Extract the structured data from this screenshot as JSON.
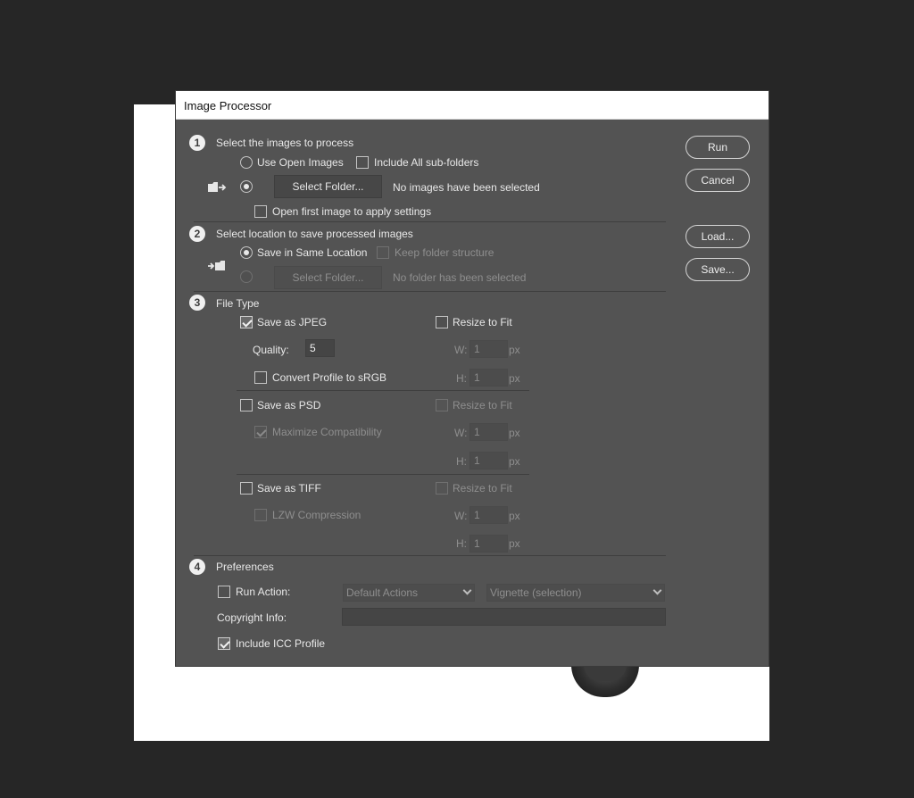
{
  "dialog": {
    "title": "Image Processor",
    "buttons": {
      "run": "Run",
      "cancel": "Cancel",
      "load": "Load...",
      "save": "Save..."
    }
  },
  "section1": {
    "number": "1",
    "title": "Select the images to process",
    "use_open_images": "Use Open Images",
    "include_subfolders": "Include All sub-folders",
    "select_folder": "Select Folder...",
    "status": "No images have been selected",
    "open_first_image": "Open first image to apply settings"
  },
  "section2": {
    "number": "2",
    "title": "Select location to save processed images",
    "save_same_location": "Save in Same Location",
    "keep_structure": "Keep folder structure",
    "select_folder": "Select Folder...",
    "status": "No folder has been selected"
  },
  "section3": {
    "number": "3",
    "title": "File Type",
    "jpeg": {
      "save_label": "Save as JPEG",
      "resize_label": "Resize to Fit",
      "quality_label": "Quality:",
      "quality_value": "5",
      "convert_profile": "Convert Profile to sRGB",
      "w_label": "W:",
      "w_value": "1",
      "h_label": "H:",
      "h_value": "1",
      "unit": "px"
    },
    "psd": {
      "save_label": "Save as PSD",
      "resize_label": "Resize to Fit",
      "maximize": "Maximize Compatibility",
      "w_label": "W:",
      "w_value": "1",
      "h_label": "H:",
      "h_value": "1",
      "unit": "px"
    },
    "tiff": {
      "save_label": "Save as TIFF",
      "resize_label": "Resize to Fit",
      "lzw": "LZW Compression",
      "w_label": "W:",
      "w_value": "1",
      "h_label": "H:",
      "h_value": "1",
      "unit": "px"
    }
  },
  "section4": {
    "number": "4",
    "title": "Preferences",
    "run_action": "Run Action:",
    "action_set": "Default Actions",
    "action": "Vignette (selection)",
    "copyright_label": "Copyright Info:",
    "copyright_value": "",
    "include_icc": "Include ICC Profile"
  },
  "colors": {
    "dialog_bg": "#535353",
    "page_bg": "#262626",
    "canvas": "#ffffff"
  }
}
